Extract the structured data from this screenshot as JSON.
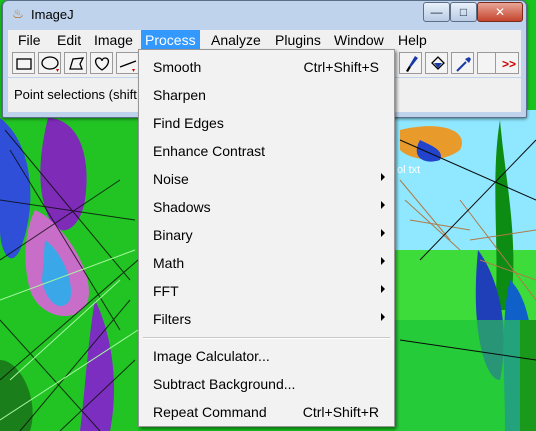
{
  "window": {
    "title": "ImageJ",
    "controls": {
      "minimize": "—",
      "maximize": "□",
      "close": "✕"
    }
  },
  "menubar": {
    "items": [
      {
        "id": "file",
        "label": "File"
      },
      {
        "id": "edit",
        "label": "Edit"
      },
      {
        "id": "image",
        "label": "Image"
      },
      {
        "id": "process",
        "label": "Process"
      },
      {
        "id": "analyze",
        "label": "Analyze"
      },
      {
        "id": "plugins",
        "label": "Plugins"
      },
      {
        "id": "window",
        "label": "Window"
      },
      {
        "id": "help",
        "label": "Help"
      }
    ],
    "active": "Process"
  },
  "toolbar": {
    "tools": [
      "rectangle-tool-icon",
      "oval-tool-icon",
      "polygon-tool-icon",
      "freehand-tool-icon",
      "line-tool-icon",
      "brush-tool-icon",
      "flood-fill-tool-icon",
      "pick-color-tool-icon",
      "blank-tool",
      "more-tools-icon"
    ],
    "more_tools_label": ">>",
    "accent_red": "#cc0000"
  },
  "status": {
    "text": "Point selections (shift c"
  },
  "process_menu": {
    "items": [
      {
        "label": "Smooth",
        "shortcut": "Ctrl+Shift+S",
        "submenu": false
      },
      {
        "label": "Sharpen",
        "shortcut": "",
        "submenu": false
      },
      {
        "label": "Find Edges",
        "shortcut": "",
        "submenu": false
      },
      {
        "label": "Enhance Contrast",
        "shortcut": "",
        "submenu": false
      },
      {
        "label": "Noise",
        "shortcut": "",
        "submenu": true
      },
      {
        "label": "Shadows",
        "shortcut": "",
        "submenu": true
      },
      {
        "label": "Binary",
        "shortcut": "",
        "submenu": true
      },
      {
        "label": "Math",
        "shortcut": "",
        "submenu": true
      },
      {
        "label": "FFT",
        "shortcut": "",
        "submenu": true
      },
      {
        "label": "Filters",
        "shortcut": "",
        "submenu": true
      },
      {
        "label": "Image Calculator...",
        "shortcut": "",
        "submenu": false
      },
      {
        "label": "Subtract Background...",
        "shortcut": "",
        "submenu": false
      },
      {
        "label": "Repeat Command",
        "shortcut": "Ctrl+Shift+R",
        "submenu": false
      }
    ]
  },
  "background": {
    "label": "ol txt"
  },
  "colors": {
    "menu_highlight": "#3399ff",
    "title_bar": "#bfd4ec",
    "background_green": "#18c41e"
  }
}
